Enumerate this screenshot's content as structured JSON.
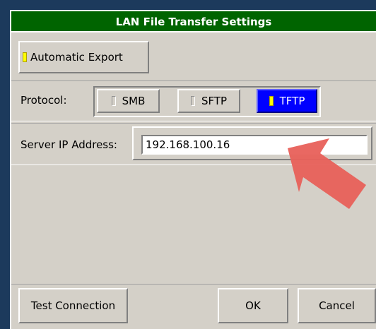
{
  "window": {
    "title": "LAN File Transfer Settings"
  },
  "auto_export": {
    "label": "Automatic Export",
    "enabled": true
  },
  "protocol": {
    "label": "Protocol:",
    "options": [
      {
        "label": "SMB",
        "selected": false
      },
      {
        "label": "SFTP",
        "selected": false
      },
      {
        "label": "TFTP",
        "selected": true
      }
    ]
  },
  "server": {
    "label": "Server IP Address:",
    "value": "192.168.100.16"
  },
  "footer": {
    "test_label": "Test Connection",
    "ok_label": "OK",
    "cancel_label": "Cancel"
  },
  "colors": {
    "titlebar": "#006400",
    "selected": "#0000ff",
    "indicator_on": "#ffff00",
    "pointer_arrow": "#e8605a"
  },
  "annotation": {
    "icon": "pointer-arrow-icon"
  }
}
